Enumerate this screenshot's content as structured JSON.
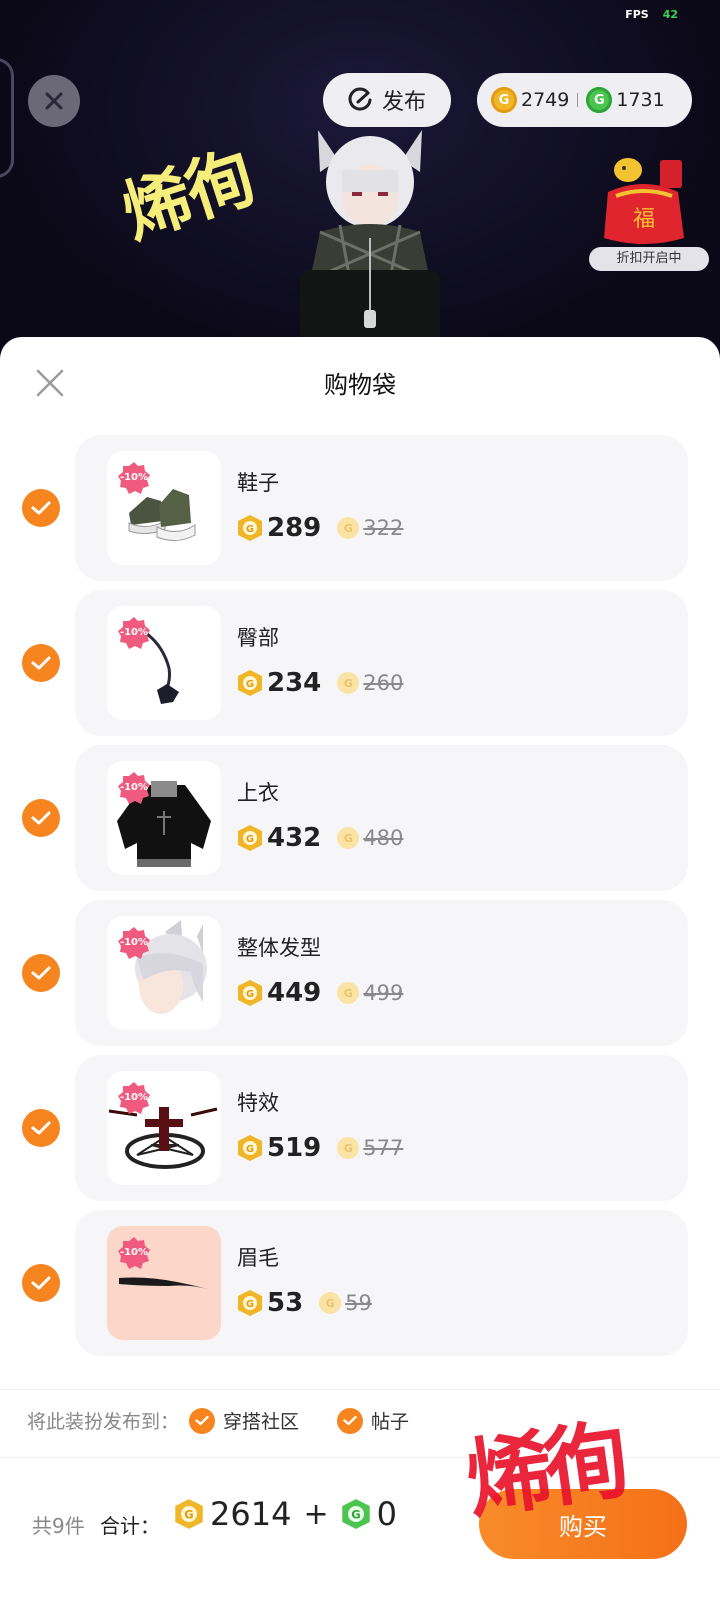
{
  "status": {
    "fps_label": "FPS",
    "fps_value": "42"
  },
  "header": {
    "publish_label": "发布",
    "gold_balance": "2749",
    "green_balance": "1731",
    "discount_tag": "折扣开启中",
    "watermark": "烯徇"
  },
  "sheet": {
    "title": "购物袋",
    "items": [
      {
        "name": "鞋子",
        "price": "289",
        "old_price": "322",
        "discount": "-10%"
      },
      {
        "name": "臀部",
        "price": "234",
        "old_price": "260",
        "discount": "-10%"
      },
      {
        "name": "上衣",
        "price": "432",
        "old_price": "480",
        "discount": "-10%"
      },
      {
        "name": "整体发型",
        "price": "449",
        "old_price": "499",
        "discount": "-10%"
      },
      {
        "name": "特效",
        "price": "519",
        "old_price": "577",
        "discount": "-10%"
      },
      {
        "name": "眉毛",
        "price": "53",
        "old_price": "59",
        "discount": "-10%"
      }
    ],
    "publish_to_label": "将此装扮发布到：",
    "options": [
      {
        "label": "穿搭社区"
      },
      {
        "label": "帖子"
      }
    ]
  },
  "footer": {
    "count_label": "共9件",
    "total_label": "合计：",
    "gold_total": "2614",
    "plus": "+",
    "green_total": "0",
    "buy_label": "购买",
    "watermark": "烯徇"
  },
  "colors": {
    "accent": "#f6841f",
    "gold": "#f1b528",
    "green": "#4cc450",
    "badge": "#f05a7e"
  }
}
